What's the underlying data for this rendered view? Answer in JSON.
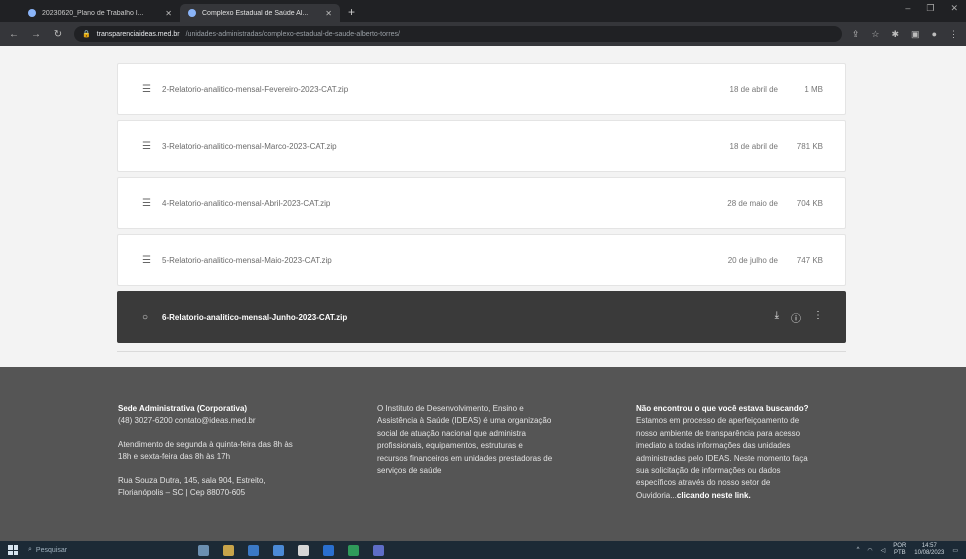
{
  "browser": {
    "tabs": [
      {
        "title": "20230620_Plano de Trabalho I...",
        "active": false
      },
      {
        "title": "Complexo Estadual de Saúde Al...",
        "active": true
      }
    ],
    "url_host": "transparenciaideas.med.br",
    "url_path": "/unidades-administradas/complexo-estadual-de-saude-alberto-torres/"
  },
  "files": [
    {
      "name": "2-Relatorio-analitico-mensal-Fevereiro-2023-CAT.zip",
      "date": "18 de abril de",
      "size": "1 MB"
    },
    {
      "name": "3-Relatorio-analitico-mensal-Marco-2023-CAT.zip",
      "date": "18 de abril de",
      "size": "781 KB"
    },
    {
      "name": "4-Relatorio-analitico-mensal-Abril-2023-CAT.zip",
      "date": "28 de maio de",
      "size": "704 KB"
    },
    {
      "name": "5-Relatorio-analitico-mensal-Maio-2023-CAT.zip",
      "date": "20 de julho de",
      "size": "747 KB"
    },
    {
      "name": "6-Relatorio-analitico-mensal-Junho-2023-CAT.zip",
      "date": "",
      "size": ""
    }
  ],
  "footer": {
    "col1": {
      "heading": "Sede Administrativa (Corporativa)",
      "contact": "(48) 3027-6200 contato@ideas.med.br",
      "hours_1": "Atendimento de segunda à quinta-feira das 8h às",
      "hours_2": "18h e sexta-feira das 8h às 17h",
      "address_1": "Rua Souza Dutra, 145, sala 904, Estreito,",
      "address_2": "Florianópolis – SC | Cep 88070-605"
    },
    "col2": {
      "lines": [
        "O Instituto de Desenvolvimento, Ensino e",
        "Assistência à Saúde (IDEAS) é uma organização",
        "social de atuação nacional que administra",
        "profissionais, equipamentos, estruturas e",
        "recursos financeiros em unidades prestadoras de",
        "serviços de saúde"
      ]
    },
    "col3": {
      "heading": "Não encontrou o que você estava buscando?",
      "lines": [
        "Estamos em processo de aperfeiçoamento de",
        "nosso ambiente de transparência para acesso",
        "imediato a todas informações das unidades",
        "administradas pelo IDEAS. Neste momento faça",
        "sua solicitação de informações ou dados",
        "específicos através do nosso setor de"
      ],
      "last_prefix": "Ouvidoria...",
      "link": "clicando neste link."
    }
  },
  "taskbar": {
    "search_placeholder": "Pesquisar",
    "lang": "POR",
    "lang2": "PTB",
    "time": "14:57",
    "date": "10/08/2023"
  },
  "colors": {
    "active_row": "#3a3a3a",
    "footer_bg": "#555555",
    "page_bg": "#f3f3f3"
  }
}
